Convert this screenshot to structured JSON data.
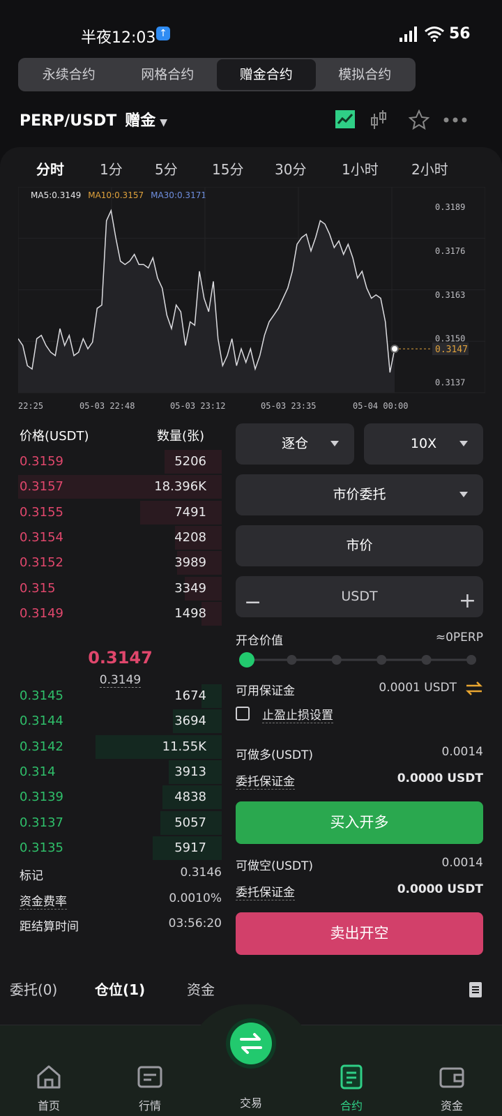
{
  "status_bar": {
    "time": "半夜12:03",
    "battery": "56"
  },
  "mode_tabs": [
    {
      "label": "永续合约",
      "active": false
    },
    {
      "label": "网格合约",
      "active": false
    },
    {
      "label": "赠金合约",
      "active": true
    },
    {
      "label": "模拟合约",
      "active": false
    }
  ],
  "pair": {
    "symbol": "PERP/USDT",
    "bonus": "赠金"
  },
  "header_icons": [
    "line-chart-icon",
    "candlestick-icon",
    "star-icon",
    "more-icon"
  ],
  "intervals": [
    {
      "label": "分时",
      "active": true
    },
    {
      "label": "1分",
      "active": false
    },
    {
      "label": "5分",
      "active": false
    },
    {
      "label": "15分",
      "active": false
    },
    {
      "label": "30分",
      "active": false
    },
    {
      "label": "1小时",
      "active": false
    },
    {
      "label": "2小时",
      "active": false
    }
  ],
  "chart_data": {
    "type": "line",
    "ma": {
      "ma5": "MA5:0.3149",
      "ma10": "MA10:0.3157",
      "ma30": "MA30:0.3171"
    },
    "y_ticks": [
      "0.3189",
      "0.3176",
      "0.3163",
      "0.3150",
      "0.3137"
    ],
    "ylim": [
      0.3134,
      0.3195
    ],
    "x_ticks": [
      "22:25",
      "05-03 22:48",
      "05-03 23:12",
      "05-03 23:35",
      "05-04 00:00"
    ],
    "last_value_label": "0.3147",
    "last_value": 0.3147,
    "series": [
      {
        "values": [
          0.315,
          0.3148,
          0.3142,
          0.3141,
          0.315,
          0.3151,
          0.3148,
          0.3146,
          0.3145,
          0.3153,
          0.3148,
          0.3151,
          0.3145,
          0.3146,
          0.315,
          0.3147,
          0.3149,
          0.3159,
          0.316,
          0.3185,
          0.3188,
          0.318,
          0.3173,
          0.3172,
          0.3173,
          0.3175,
          0.3172,
          0.3172,
          0.3171,
          0.3174,
          0.3168,
          0.3165,
          0.3157,
          0.3153,
          0.316,
          0.3158,
          0.3148,
          0.3155,
          0.3154,
          0.317,
          0.3162,
          0.3158,
          0.3167,
          0.315,
          0.3142,
          0.3145,
          0.315,
          0.3142,
          0.3147,
          0.3143,
          0.3147,
          0.3141,
          0.3145,
          0.3151,
          0.3155,
          0.3157,
          0.3159,
          0.3162,
          0.3165,
          0.317,
          0.3178,
          0.318,
          0.3181,
          0.3176,
          0.318,
          0.3185,
          0.3184,
          0.3181,
          0.3177,
          0.3179,
          0.3175,
          0.3178,
          0.3174,
          0.3168,
          0.317,
          0.3165,
          0.3162,
          0.3163,
          0.3162,
          0.3155,
          0.314,
          0.3147
        ]
      }
    ]
  },
  "order_book": {
    "price_header": "价格(USDT)",
    "qty_header": "数量(张)",
    "asks": [
      {
        "price": "0.3159",
        "qty": "5206",
        "depth": 0.28
      },
      {
        "price": "0.3157",
        "qty": "18.396K",
        "depth": 1.0
      },
      {
        "price": "0.3155",
        "qty": "7491",
        "depth": 0.4
      },
      {
        "price": "0.3154",
        "qty": "4208",
        "depth": 0.23
      },
      {
        "price": "0.3152",
        "qty": "3989",
        "depth": 0.22
      },
      {
        "price": "0.315",
        "qty": "3349",
        "depth": 0.18
      },
      {
        "price": "0.3149",
        "qty": "1498",
        "depth": 0.1
      }
    ],
    "last_price": "0.3147",
    "mark_price": "0.3149",
    "bids": [
      {
        "price": "0.3145",
        "qty": "1674",
        "depth": 0.1
      },
      {
        "price": "0.3144",
        "qty": "3694",
        "depth": 0.24
      },
      {
        "price": "0.3142",
        "qty": "11.55K",
        "depth": 0.62
      },
      {
        "price": "0.314",
        "qty": "3913",
        "depth": 0.26
      },
      {
        "price": "0.3139",
        "qty": "4838",
        "depth": 0.29
      },
      {
        "price": "0.3137",
        "qty": "5057",
        "depth": 0.3
      },
      {
        "price": "0.3135",
        "qty": "5917",
        "depth": 0.34
      }
    ],
    "info": [
      {
        "label": "标记",
        "value": "0.3146"
      },
      {
        "label": "资金费率",
        "value": "0.0010%"
      },
      {
        "label": "距结算时间",
        "value": "03:56:20"
      }
    ]
  },
  "order_form": {
    "margin_mode": "逐仓",
    "leverage": "10X",
    "order_type": "市价委托",
    "price_field": "市价",
    "amount_unit": "USDT",
    "open_value_label": "开仓价值",
    "open_value": "≈0PERP",
    "slider_fraction": 0,
    "available_label": "可用保证金",
    "available_value": "0.0001 USDT",
    "tpsl_label": "止盈止损设置",
    "long_label": "可做多(USDT)",
    "long_value": "0.0014",
    "margin_label": "委托保证金",
    "long_margin_value": "0.0000 USDT",
    "buy_button": "买入开多",
    "short_label": "可做空(USDT)",
    "short_value": "0.0014",
    "short_margin_value": "0.0000 USDT",
    "sell_button": "卖出开空"
  },
  "position_tabs": [
    {
      "label": "委托(0)",
      "active": false
    },
    {
      "label": "仓位(1)",
      "active": true
    },
    {
      "label": "资金",
      "active": false
    }
  ],
  "nav": [
    {
      "label": "首页",
      "icon": "home-icon",
      "active": false
    },
    {
      "label": "行情",
      "icon": "market-icon",
      "active": false
    },
    {
      "label": "交易",
      "icon": "swap-icon",
      "active": false
    },
    {
      "label": "合约",
      "icon": "contract-icon",
      "active": true
    },
    {
      "label": "资金",
      "icon": "wallet-icon",
      "active": false
    }
  ],
  "colors": {
    "up": "#2fbf6a",
    "down": "#e0476c",
    "accent": "#22c96e"
  }
}
